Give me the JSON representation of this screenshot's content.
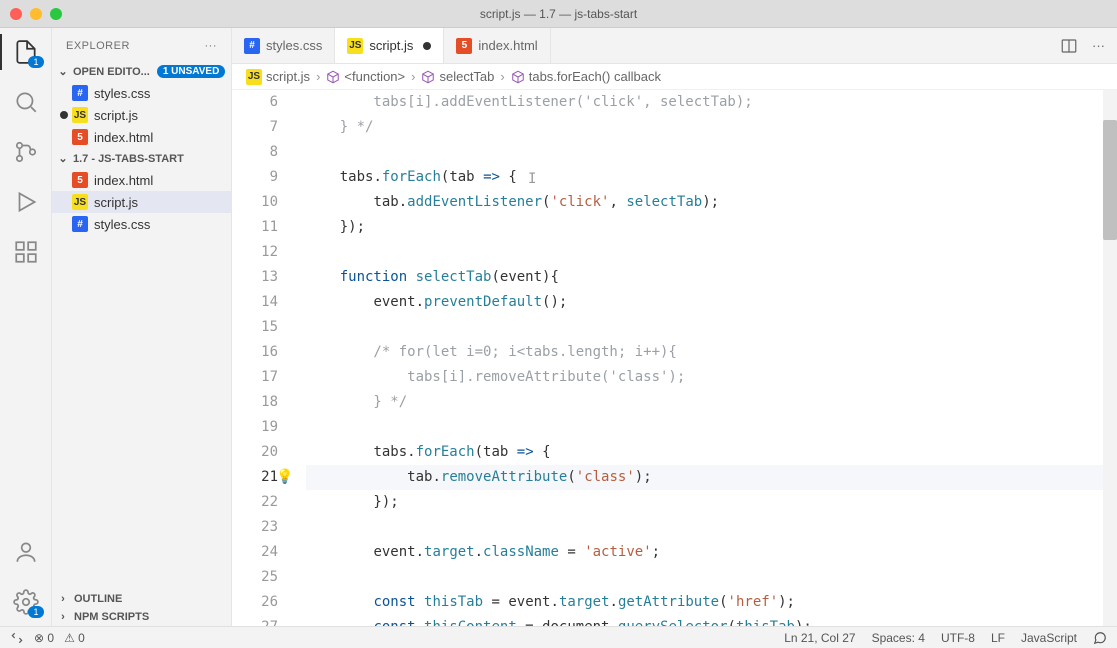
{
  "window": {
    "title": "script.js — 1.7 — js-tabs-start"
  },
  "activityBar": {
    "explorerBadge": "1",
    "settingsBadge": "1"
  },
  "sidebar": {
    "title": "EXPLORER",
    "openEditors": {
      "label": "OPEN EDITO...",
      "unsaved": "1 UNSAVED",
      "items": [
        {
          "name": "styles.css",
          "icon": "css",
          "dirty": false
        },
        {
          "name": "script.js",
          "icon": "js",
          "dirty": true
        },
        {
          "name": "index.html",
          "icon": "html",
          "dirty": false
        }
      ]
    },
    "folder": {
      "label": "1.7 - JS-TABS-START",
      "items": [
        {
          "name": "index.html",
          "icon": "html"
        },
        {
          "name": "script.js",
          "icon": "js",
          "active": true
        },
        {
          "name": "styles.css",
          "icon": "css"
        }
      ]
    },
    "bottom": [
      {
        "label": "OUTLINE"
      },
      {
        "label": "NPM SCRIPTS"
      }
    ]
  },
  "tabs": [
    {
      "name": "styles.css",
      "icon": "css",
      "dirty": false,
      "active": false
    },
    {
      "name": "script.js",
      "icon": "js",
      "dirty": true,
      "active": true
    },
    {
      "name": "index.html",
      "icon": "html",
      "dirty": false,
      "active": false
    }
  ],
  "breadcrumbs": {
    "items": [
      {
        "icon": "js",
        "label": "script.js"
      },
      {
        "icon": "cube",
        "label": "<function>"
      },
      {
        "icon": "cube",
        "label": "selectTab"
      },
      {
        "icon": "cube",
        "label": "tabs.forEach() callback"
      }
    ]
  },
  "editor": {
    "startLine": 6,
    "currentLine": 21,
    "lines": [
      "        tabs[i].addEventListener('click', selectTab);",
      "    } */",
      "",
      "    tabs.forEach(tab => {",
      "        tab.addEventListener('click', selectTab);",
      "    });",
      "",
      "    function selectTab(event){",
      "        event.preventDefault();",
      "",
      "        /* for(let i=0; i<tabs.length; i++){",
      "            tabs[i].removeAttribute('class');",
      "        } */",
      "",
      "        tabs.forEach(tab => {",
      "            tab.removeAttribute('class');",
      "        });",
      "",
      "        event.target.className = 'active';",
      "",
      "        const thisTab = event.target.getAttribute('href');",
      "        const thisContent = document.querySelector(thisTab);"
    ]
  },
  "statusBar": {
    "left": {
      "errors": "0",
      "warnings": "0"
    },
    "right": {
      "position": "Ln 21, Col 27",
      "spaces": "Spaces: 4",
      "encoding": "UTF-8",
      "eol": "LF",
      "language": "JavaScript"
    }
  }
}
